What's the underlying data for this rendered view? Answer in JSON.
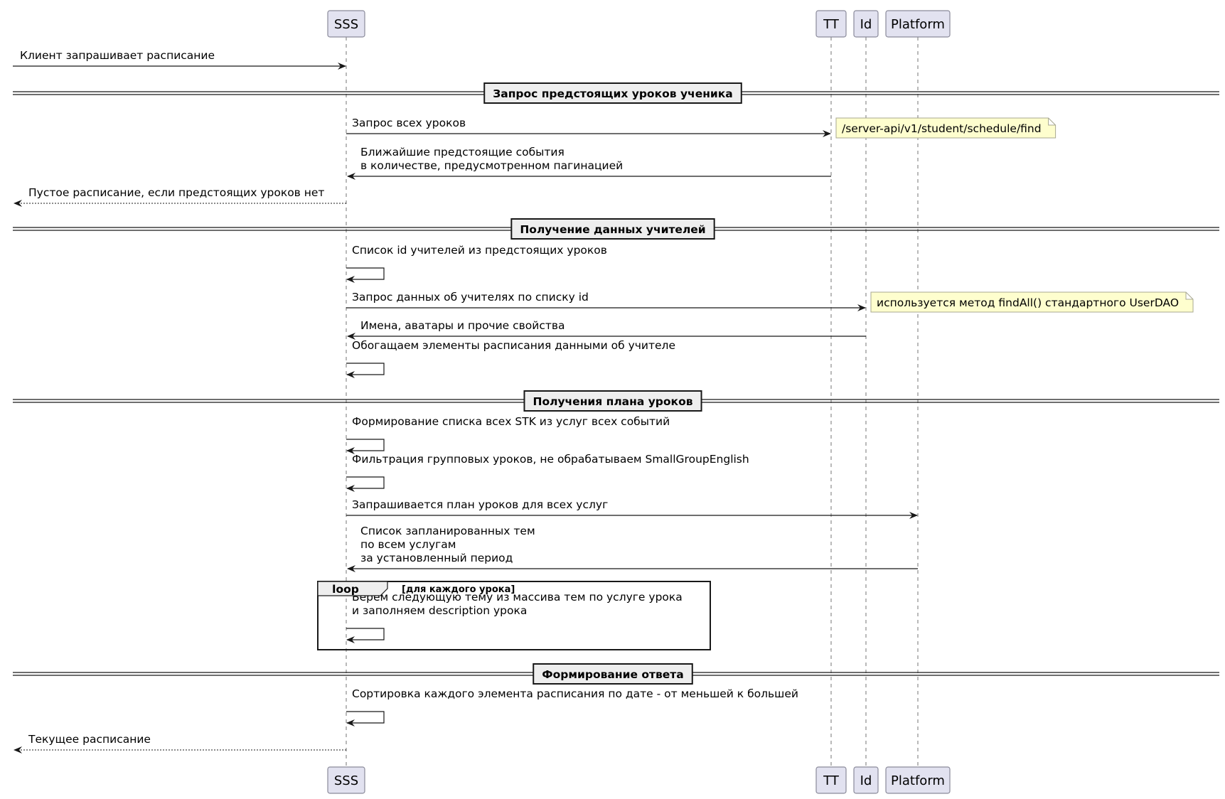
{
  "diagram": {
    "type": "sequence",
    "participants": [
      {
        "id": "SSS",
        "label": "SSS"
      },
      {
        "id": "TT",
        "label": "TT"
      },
      {
        "id": "Id",
        "label": "Id"
      },
      {
        "id": "Platform",
        "label": "Platform"
      }
    ],
    "messages": [
      {
        "from": "left",
        "to": "SSS",
        "style": "solid",
        "lines": [
          "Клиент запрашивает расписание"
        ]
      },
      {
        "divider": "Запрос предстоящих уроков ученика"
      },
      {
        "from": "SSS",
        "to": "TT",
        "style": "solid",
        "lines": [
          "Запрос всех уроков"
        ],
        "note": "/server-api/v1/student/schedule/find"
      },
      {
        "from": "TT",
        "to": "SSS",
        "style": "solid",
        "lines": [
          "Ближайшие предстоящие события",
          "в количестве, предусмотренном пагинацией"
        ]
      },
      {
        "from": "SSS",
        "to": "left",
        "style": "dotted",
        "lines": [
          "Пустое расписание, если предстоящих уроков нет"
        ]
      },
      {
        "divider": "Получение данных учителей"
      },
      {
        "from": "SSS",
        "to": "SSS",
        "style": "self",
        "lines": [
          "Список id учителей из предстоящих уроков"
        ]
      },
      {
        "from": "SSS",
        "to": "Id",
        "style": "solid",
        "lines": [
          "Запрос данных об учителях по списку id"
        ],
        "note": "используется метод findAll() стандартного UserDAO"
      },
      {
        "from": "Id",
        "to": "SSS",
        "style": "solid",
        "lines": [
          "Имена, аватары и прочие свойства"
        ]
      },
      {
        "from": "SSS",
        "to": "SSS",
        "style": "self",
        "lines": [
          "Обогащаем элементы расписания данными об учителе"
        ]
      },
      {
        "divider": "Получения плана уроков"
      },
      {
        "from": "SSS",
        "to": "SSS",
        "style": "self",
        "lines": [
          "Формирование списка всех STK из услуг всех событий"
        ]
      },
      {
        "from": "SSS",
        "to": "SSS",
        "style": "self",
        "lines": [
          "Фильтрация групповых уроков, не обрабатываем SmallGroupEnglish"
        ]
      },
      {
        "from": "SSS",
        "to": "Platform",
        "style": "solid",
        "lines": [
          "Запрашивается план уроков для всех услуг"
        ]
      },
      {
        "from": "Platform",
        "to": "SSS",
        "style": "solid",
        "lines": [
          "Список запланированных тем",
          "по всем услугам",
          "за установленный период"
        ]
      },
      {
        "loop": {
          "keyword": "loop",
          "condition": "[для каждого урока]"
        },
        "from": "SSS",
        "to": "SSS",
        "style": "self",
        "lines": [
          "Берём следующую тему из массива тем по услуге урока",
          " и заполняем description урока"
        ]
      },
      {
        "divider": "Формирование ответа"
      },
      {
        "from": "SSS",
        "to": "SSS",
        "style": "self",
        "lines": [
          "Сортировка каждого элемента расписания по дате - от меньшей к большей"
        ]
      },
      {
        "from": "SSS",
        "to": "left",
        "style": "dotted",
        "lines": [
          "Текущее расписание"
        ]
      }
    ]
  },
  "colors": {
    "participant_fill": "#e2e2f0",
    "participant_stroke": "#8a8a9a",
    "note_fill": "#fefece",
    "note_stroke": "#a8a890",
    "divider_fill": "#eeeeee",
    "line": "#181818"
  }
}
